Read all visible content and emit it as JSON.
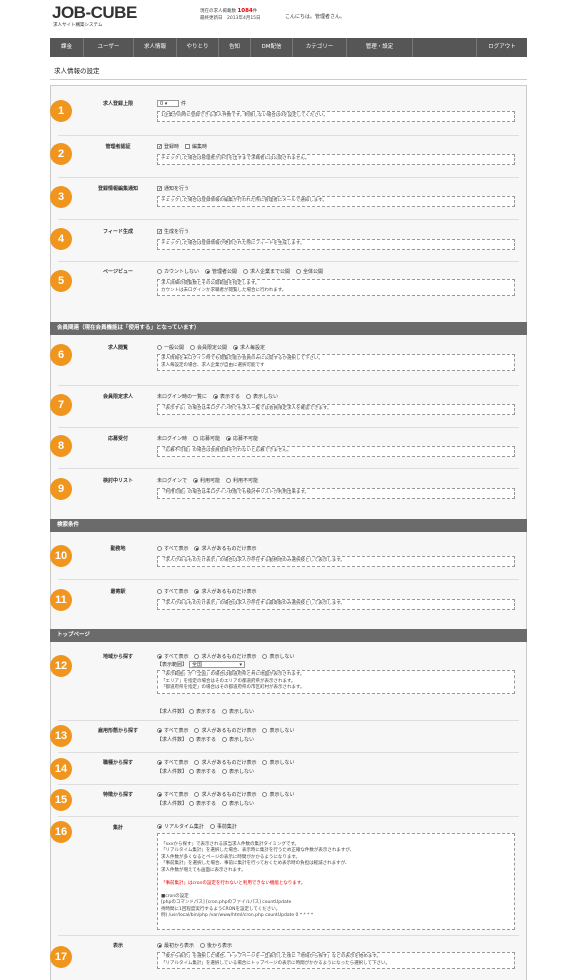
{
  "header": {
    "logo": "JOB-CUBE",
    "logo_sub": "求人サイト構築システム",
    "stat_line1_prefix": "現在の求人掲載数",
    "stat_count": "1084",
    "stat_unit": "件",
    "stat_line2": "最終更新日　2013年4月15日",
    "greeting": "こんにちは。管理者さん。"
  },
  "nav": {
    "items": [
      "課金",
      "ユーザー",
      "求人情報",
      "やりとり",
      "告知",
      "DM配信",
      "カテゴリー",
      "管理・設定"
    ],
    "logout": "ログアウト"
  },
  "page_title": "求人情報の設定",
  "sections": {
    "member": "会員関連（現在会員機能は「使用する」となっています）",
    "search": "検索条件",
    "top": "トップページ"
  },
  "rows": {
    "r1": {
      "num": "1",
      "label": "求人登録上限",
      "select": "0",
      "unit": "件",
      "desc": "1企業が同時に登録できる求人件数です。制限しない場合は0を設定してください。"
    },
    "r2": {
      "num": "2",
      "label": "管理者認証",
      "opt1": "登録時",
      "opt2": "編集時",
      "desc": "チェックした場合は管理者が許可を出すまで求職者には公開されません。"
    },
    "r3": {
      "num": "3",
      "label": "登録情報編集通知",
      "opt1": "通知を行う",
      "desc": "チェックした場合は登録情報の編集が行われた際に管理者にメールで通知します。"
    },
    "r4": {
      "num": "4",
      "label": "フィード生成",
      "opt1": "生成を行う",
      "desc": "チェックした場合は登録情報が更新された際にフィードを生成します。"
    },
    "r5": {
      "num": "5",
      "label": "ページビュー",
      "opt1": "カウントしない",
      "opt2": "管理者公開",
      "opt3": "求人企業まで公開",
      "opt4": "全体公開",
      "desc": "求人詳細の閲覧数とその公開範囲を指定します。\nカウントは未ログインか求職者が閲覧した場合に行われます。"
    },
    "r6": {
      "num": "6",
      "label": "求人閲覧",
      "opt1": "一般公開",
      "opt2": "会員限定公開",
      "opt3": "求人毎設定",
      "desc": "求人情報を未ログイン時でも閲覧可能か会員のみに公開するか選択して下さい。\n求人毎設定の場合、求人企業が自由に選択可能です"
    },
    "r7": {
      "num": "7",
      "label": "会員限定求人",
      "prefix": "未ログイン時の一覧に",
      "opt1": "表示する",
      "opt2": "表示しない",
      "desc": "「表示する」の場合は未ログイン時でも求人一覧では会員限定求人を確認できます。"
    },
    "r8": {
      "num": "8",
      "label": "応募受付",
      "prefix": "未ログイン時",
      "opt1": "応募可能",
      "opt2": "応募不可能",
      "desc": "「応募不可能」の場合は会員登録を行わないと応募できません。"
    },
    "r9": {
      "num": "9",
      "label": "検討中リスト",
      "prefix": "未ログインで",
      "opt1": "利用可能",
      "opt2": "利用不可能",
      "desc": "「利用可能」の場合は未ログイン状態でも検討中リストが利用出来ます。"
    },
    "r10": {
      "num": "10",
      "label": "勤務地",
      "opt1": "すべて表示",
      "opt2": "求人があるものだけ表示",
      "desc": "「求人があるものだけ表示」の場合は求人が存在する勤務地のみ選択肢として表示します。"
    },
    "r11": {
      "num": "11",
      "label": "最寄駅",
      "opt1": "すべて表示",
      "opt2": "求人があるものだけ表示",
      "desc": "「求人があるものだけ表示」の場合は求人が存在する最寄駅のみ選択肢として表示します。"
    },
    "r12": {
      "num": "12",
      "label": "地域から探す",
      "opt1": "すべて表示",
      "opt2": "求人があるものだけ表示",
      "opt3": "表示しない",
      "range_label": "【表示範囲】",
      "range_value": "全国",
      "desc": "「表示範囲」が「全国」の場合は都道府県と共に地図が表示されます。\n「エリア」を指定の場合はそのエリアの都道府県が表示されます。\n「都道府県を指定」の場合はその都道府県の市区町村が表示されます。",
      "count_label": "【求人件数】",
      "count_opt1": "表示する",
      "count_opt2": "表示しない"
    },
    "r13": {
      "num": "13",
      "label": "雇用形態から探す",
      "opt1": "すべて表示",
      "opt2": "求人があるものだけ表示",
      "opt3": "表示しない",
      "count_label": "【求人件数】",
      "count_opt1": "表示する",
      "count_opt2": "表示しない"
    },
    "r14": {
      "num": "14",
      "label": "職種から探す",
      "opt1": "すべて表示",
      "opt2": "求人があるものだけ表示",
      "opt3": "表示しない",
      "count_label": "【求人件数】",
      "count_opt1": "表示する",
      "count_opt2": "表示しない"
    },
    "r15": {
      "num": "15",
      "label": "特徴から探す",
      "opt1": "すべて表示",
      "opt2": "求人があるものだけ表示",
      "opt3": "表示しない",
      "count_label": "【求人件数】",
      "count_opt1": "表示する",
      "count_opt2": "表示しない"
    },
    "r16": {
      "num": "16",
      "label": "集計",
      "opt1": "リアルタイム集計",
      "opt2": "事前集計",
      "desc1": "「xxxから探す」で表示される該当求人件数の集計タイミングです。\n「リアルタイム集計」を選択した場合、表示時に集計を行うため正確な件数が表示されますが、\n求人件数が多くなるとページの表示に時間がかかるようになります。\n「事前集計」を選択した場合、事前に集計を行っておくため表示時の負担は軽減されますが、\n求人件数が増えても画面に表示されます。",
      "desc_red": "「事前集計」はcronの設定を行わないと利用できない機能となります。",
      "desc2": "■cronの設定\n[phpのコマンドパス] [cron.phpのファイルパス] countUpdate\n待時間に1回程度実行するようCRONを設定してください。\n例) /usr/local/bin/php /var/www/html/cron.php countUpdate 0 * * * *"
    },
    "r17": {
      "num": "17",
      "label": "表示",
      "opt1": "最初から表示",
      "opt2": "後から表示",
      "desc": "「後から表示」を選択した場合、トップページを一旦表示した後に「地域から探す」などの表示を始めます。\n「リアルタイム集計」を選択している場合にトップページの表示に時間がかかるようになったら選択して下さい。"
    }
  }
}
